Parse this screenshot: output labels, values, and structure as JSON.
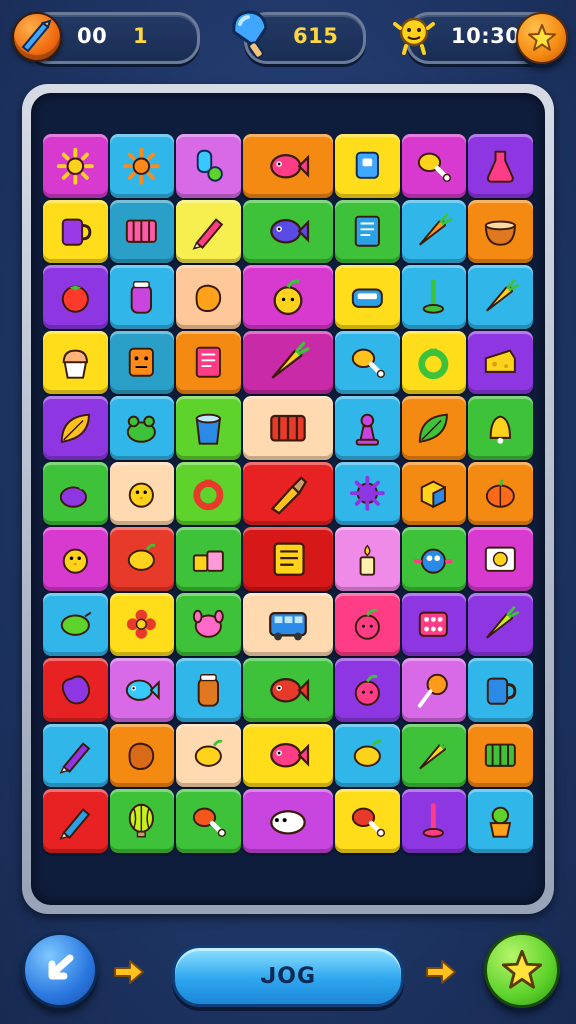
{
  "hud": {
    "coins_value": "00",
    "coins_suffix": "1",
    "gems_value": "615",
    "time_value": "10:309"
  },
  "bottom": {
    "play_label": "ᒍOG"
  },
  "colors": {
    "background": "#1e3564",
    "board": "#0f1d3c",
    "accent_blue": "#2fa7f0",
    "accent_green": "#5ed32b",
    "accent_orange": "#f58a12"
  },
  "tiles": [
    {
      "color": "#d83ad0",
      "icon": "sun-icon",
      "fg": "#ffd21c"
    },
    {
      "color": "#31b6ea",
      "icon": "sun-icon",
      "fg": "#ff8a1a"
    },
    {
      "color": "#d86ae8",
      "icon": "gummy-icon",
      "fg": "#36c8ff"
    },
    {
      "color": "#f58a12",
      "icon": "fish-icon",
      "fg": "#ff3d86",
      "wide": true
    },
    {
      "color": "#ffdd1a",
      "icon": "box-icon",
      "fg": "#3fa7ff"
    },
    {
      "color": "#d83ad0",
      "icon": "drumstick-icon",
      "fg": "#ffd21c"
    },
    {
      "color": "#8e36e2",
      "icon": "flask-icon",
      "fg": "#ff3d86"
    },
    {
      "color": "#ffdd1a",
      "icon": "cup-icon",
      "fg": "#9a3ae6"
    },
    {
      "color": "#2aa0c8",
      "icon": "crate-icon",
      "fg": "#ff5aa8"
    },
    {
      "color": "#f7ee50",
      "icon": "crayon-icon",
      "fg": "#ff3d86"
    },
    {
      "color": "#3ec23a",
      "icon": "fish-icon",
      "fg": "#5a4be6",
      "wide": true
    },
    {
      "color": "#3ec23a",
      "icon": "book-icon",
      "fg": "#2aa0e6"
    },
    {
      "color": "#31b6ea",
      "icon": "carrot-icon",
      "fg": "#ff9a1a"
    },
    {
      "color": "#f58a12",
      "icon": "bowl-icon",
      "fg": "#e07820"
    },
    {
      "color": "#8e36e2",
      "icon": "tomato-icon",
      "fg": "#ff3a2a"
    },
    {
      "color": "#31b6ea",
      "icon": "jar-icon",
      "fg": "#c845e0"
    },
    {
      "color": "#ffc89a",
      "icon": "potato-icon",
      "fg": "#ffa21a"
    },
    {
      "color": "#d83ad0",
      "icon": "apple-icon",
      "fg": "#ffd21c",
      "wide": true
    },
    {
      "color": "#ffdd1a",
      "icon": "tray-icon",
      "fg": "#2aa0e6"
    },
    {
      "color": "#31b6ea",
      "icon": "pin-icon",
      "fg": "#3ec23a"
    },
    {
      "color": "#31b6ea",
      "icon": "carrot-icon",
      "fg": "#ffd21c"
    },
    {
      "color": "#ffdd1a",
      "icon": "cupcake-icon",
      "fg": "#ffb27a"
    },
    {
      "color": "#2aa0c8",
      "icon": "block-icon",
      "fg": "#ff8a1a"
    },
    {
      "color": "#f58a12",
      "icon": "book-icon",
      "fg": "#ff3d86"
    },
    {
      "color": "#c82aa8",
      "icon": "carrot-icon",
      "fg": "#ffd21c",
      "wide": true
    },
    {
      "color": "#31b6ea",
      "icon": "drumstick-icon",
      "fg": "#ffc21c"
    },
    {
      "color": "#ffdd1a",
      "icon": "ring-icon",
      "fg": "#3ec23a"
    },
    {
      "color": "#8e36e2",
      "icon": "cheese-icon",
      "fg": "#ffd21c"
    },
    {
      "color": "#8e36e2",
      "icon": "leaf-icon",
      "fg": "#ffc21c"
    },
    {
      "color": "#31b6ea",
      "icon": "frog-icon",
      "fg": "#3ec23a"
    },
    {
      "color": "#5ed32b",
      "icon": "bucket-icon",
      "fg": "#2a8ae6"
    },
    {
      "color": "#ffd9b0",
      "icon": "crate-icon",
      "fg": "#e83a2a",
      "wide": true
    },
    {
      "color": "#31b6ea",
      "icon": "pawn-icon",
      "fg": "#c845e0"
    },
    {
      "color": "#f58a12",
      "icon": "leaf-icon",
      "fg": "#3ec23a"
    },
    {
      "color": "#3ec23a",
      "icon": "bell-icon",
      "fg": "#ffd21c"
    },
    {
      "color": "#3ec23a",
      "icon": "eggplant-icon",
      "fg": "#8e36e2"
    },
    {
      "color": "#ffd9b0",
      "icon": "chick-icon",
      "fg": "#ffd21c"
    },
    {
      "color": "#5ed32b",
      "icon": "ring-icon",
      "fg": "#e83a2a"
    },
    {
      "color": "#e82222",
      "icon": "brush-icon",
      "fg": "#ffc21c",
      "wide": true
    },
    {
      "color": "#31b6ea",
      "icon": "virus-icon",
      "fg": "#8e36e2"
    },
    {
      "color": "#f58a12",
      "icon": "cube-icon",
      "fg": "#2a8ae6"
    },
    {
      "color": "#f58a12",
      "icon": "pumpkin-icon",
      "fg": "#ff6a1a"
    },
    {
      "color": "#d83ad0",
      "icon": "chick-icon",
      "fg": "#ffd21c"
    },
    {
      "color": "#e83a2a",
      "icon": "lemon-icon",
      "fg": "#ffd21c"
    },
    {
      "color": "#3ec23a",
      "icon": "blocks-icon",
      "fg": "#ffd21c"
    },
    {
      "color": "#d61818",
      "icon": "notes-icon",
      "fg": "#ffd21c",
      "wide": true
    },
    {
      "color": "#f08ae8",
      "icon": "candle-icon",
      "fg": "#ffd21c"
    },
    {
      "color": "#3ec23a",
      "icon": "robot-icon",
      "fg": "#2a8ae6"
    },
    {
      "color": "#d83ad0",
      "icon": "card-icon",
      "fg": "#ffd21c"
    },
    {
      "color": "#31b6ea",
      "icon": "lime-icon",
      "fg": "#5ed32b"
    },
    {
      "color": "#ffdd1a",
      "icon": "flower-icon",
      "fg": "#e83a2a"
    },
    {
      "color": "#3ec23a",
      "icon": "dog-icon",
      "fg": "#ff6ac8"
    },
    {
      "color": "#ffd9b0",
      "icon": "bus-icon",
      "fg": "#2a8ae6",
      "wide": true
    },
    {
      "color": "#ff3d86",
      "icon": "apple-icon",
      "fg": "#ff3d86"
    },
    {
      "color": "#8e36e2",
      "icon": "dice-icon",
      "fg": "#ff3d86"
    },
    {
      "color": "#8e36e2",
      "icon": "carrot-icon",
      "fg": "#c8f01c"
    },
    {
      "color": "#e82222",
      "icon": "blob-icon",
      "fg": "#8e36e2"
    },
    {
      "color": "#d86ae8",
      "icon": "fish-icon",
      "fg": "#36c8ff"
    },
    {
      "color": "#31b6ea",
      "icon": "jar-icon",
      "fg": "#e07820"
    },
    {
      "color": "#3ec23a",
      "icon": "fish-icon",
      "fg": "#e83a2a",
      "wide": true
    },
    {
      "color": "#8e36e2",
      "icon": "apple-icon",
      "fg": "#ff3d86"
    },
    {
      "color": "#d86ae8",
      "icon": "lollipop-icon",
      "fg": "#ff9a1a"
    },
    {
      "color": "#31b6ea",
      "icon": "cup-icon",
      "fg": "#2a8ae6"
    },
    {
      "color": "#31b6ea",
      "icon": "crayon-icon",
      "fg": "#8e36e2"
    },
    {
      "color": "#f58a12",
      "icon": "potato-icon",
      "fg": "#d86a18"
    },
    {
      "color": "#ffd9b0",
      "icon": "lemon-icon",
      "fg": "#ffd21c"
    },
    {
      "color": "#ffdd1a",
      "icon": "fish-icon",
      "fg": "#ff3d86",
      "wide": true
    },
    {
      "color": "#31b6ea",
      "icon": "lemon-icon",
      "fg": "#ffd21c"
    },
    {
      "color": "#3ec23a",
      "icon": "carrot-icon",
      "fg": "#ffd21c"
    },
    {
      "color": "#f58a12",
      "icon": "crate-icon",
      "fg": "#3ec23a"
    },
    {
      "color": "#e82222",
      "icon": "crayon-icon",
      "fg": "#2aa0e6"
    },
    {
      "color": "#3ec23a",
      "icon": "balloon-icon",
      "fg": "#c8f01c"
    },
    {
      "color": "#3ec23a",
      "icon": "drumstick-icon",
      "fg": "#f5561c"
    },
    {
      "color": "#c845e0",
      "icon": "sheep-icon",
      "fg": "#ffffff",
      "wide": true
    },
    {
      "color": "#ffdd1a",
      "icon": "drumstick-icon",
      "fg": "#e83a2a"
    },
    {
      "color": "#8e36e2",
      "icon": "pin-icon",
      "fg": "#ff3d86"
    },
    {
      "color": "#31b6ea",
      "icon": "plant-icon",
      "fg": "#ffa21a"
    }
  ]
}
